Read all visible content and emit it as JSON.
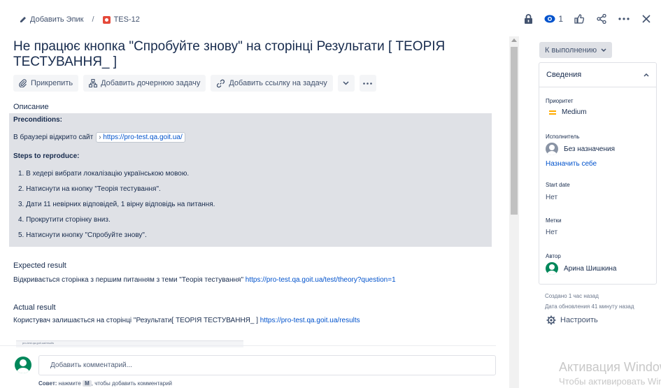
{
  "breadcrumb": {
    "add_epic": "Добавить Эпик",
    "separator": "/",
    "issue_key": "TES-12"
  },
  "top_actions": {
    "watchers_count": "1"
  },
  "issue": {
    "title": "Не працює кнопка \"Спробуйте знову\" на сторінці Результати [ ТЕОРІЯ ТЕСТУВАННЯ_ ]"
  },
  "toolbar": {
    "attach": "Прикрепить",
    "add_child": "Добавить дочернюю задачу",
    "link_issue": "Добавить ссылку на задачу"
  },
  "description": {
    "label": "Описание",
    "preconditions_heading": "Preconditions:",
    "precondition_text": "В браузері відкрито сайт",
    "precondition_link": "https://pro-test.qa.goit.ua/",
    "steps_heading": "Steps to reproduce:",
    "steps": [
      "1. В хедері вибрати локалізацію українською мовою.",
      "2. Натиснути на кнопку \"Теорія тестування\".",
      "3. Дати 11 невірних відповідей, 1 вірну відповідь на питання.",
      "4. Прокрутити сторінку вниз.",
      "5. Натиснути кнопку \"Спробуйте знову\"."
    ]
  },
  "expected": {
    "label": "Expected result",
    "text": "Відкривається сторінка з першим питанням з теми \"Теорія тестування\"",
    "link": "https://pro-test.qa.goit.ua/test/theory?question=1"
  },
  "actual": {
    "label": "Actual result",
    "text": "Користувач залишається на сторінці \"Результати[ ТЕОРІЯ ТЕСТУВАННЯ_ ]",
    "link": "https://pro-test.qa.goit.ua/results"
  },
  "attachment": {
    "caption": "pro-test.qa.goit.ua/results"
  },
  "comment": {
    "placeholder": "Добавить комментарий...",
    "hint_prefix": "Совет:",
    "hint_middle": "нажмите",
    "hint_key": "M",
    "hint_suffix": ", чтобы добавить комментарий"
  },
  "sidebar": {
    "status": "К выполнению",
    "details_title": "Сведения",
    "priority_label": "Приоритет",
    "priority_value": "Medium",
    "assignee_label": "Исполнитель",
    "assignee_value": "Без назначения",
    "assign_self": "Назначить себе",
    "start_date_label": "Start date",
    "start_date_value": "Нет",
    "labels_label": "Метки",
    "labels_value": "Нет",
    "author_label": "Автор",
    "author_value": "Арина Шишкина",
    "created": "Создано 1 час назад",
    "updated": "Дата обновления 41 минуту назад",
    "configure": "Настроить"
  },
  "watermark": {
    "line1": "Активация Windows",
    "line2": "Чтобы активировать Windows"
  },
  "colors": {
    "link": "#0052cc",
    "priority_medium": "#ffab00",
    "bug_type": "#e5493a",
    "avatar_gray": "#8993a4",
    "avatar_green": "#00875a"
  }
}
